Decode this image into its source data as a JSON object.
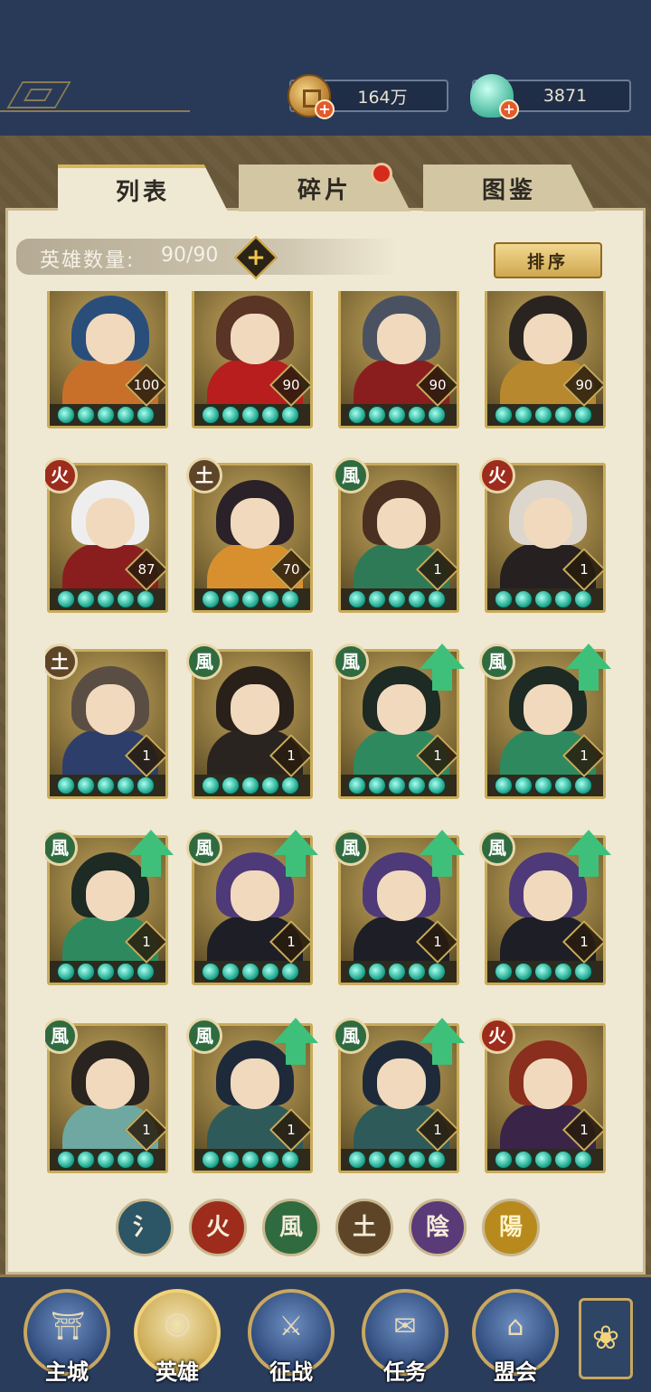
{
  "resources": {
    "coin_amount": "164万",
    "jade_amount": "3871"
  },
  "tabs": [
    {
      "label": "列表",
      "active": true
    },
    {
      "label": "碎片",
      "active": false,
      "notification": true
    },
    {
      "label": "图鉴",
      "active": false
    }
  ],
  "hero_count": {
    "label": "英雄数量:",
    "value": "90/90"
  },
  "sort_button": "排序",
  "element_glyphs": {
    "water": "氵",
    "fire": "火",
    "wind": "風",
    "earth": "土",
    "yin": "陰",
    "yang": "陽"
  },
  "element_colors": {
    "water": "#2c5566",
    "fire": "#9e2c1c",
    "wind": "#2f6b3f",
    "earth": "#5e4528",
    "yin": "#5b3a78",
    "yang": "#b88a1e"
  },
  "heroes": [
    {
      "level": "100",
      "element": null,
      "upgrade": false,
      "hair": "#2a4e7a",
      "outfit": "#c8702a"
    },
    {
      "level": "90",
      "element": null,
      "upgrade": false,
      "hair": "#5a3424",
      "outfit": "#b81e1e"
    },
    {
      "level": "90",
      "element": null,
      "upgrade": false,
      "hair": "#4a5262",
      "outfit": "#8a1e1e"
    },
    {
      "level": "90",
      "element": null,
      "upgrade": false,
      "hair": "#2a2420",
      "outfit": "#b8882e"
    },
    {
      "level": "87",
      "element": "fire",
      "upgrade": false,
      "hair": "#eeeeee",
      "outfit": "#8a1e1e"
    },
    {
      "level": "70",
      "element": "earth",
      "upgrade": false,
      "hair": "#2a2228",
      "outfit": "#d8902e"
    },
    {
      "level": "1",
      "element": "wind",
      "upgrade": false,
      "hair": "#4a3020",
      "outfit": "#2e7a56"
    },
    {
      "level": "1",
      "element": "fire",
      "upgrade": false,
      "hair": "#ddd6cc",
      "outfit": "#262020"
    },
    {
      "level": "1",
      "element": "earth",
      "upgrade": false,
      "hair": "#5a4e44",
      "outfit": "#2e3e6a"
    },
    {
      "level": "1",
      "element": "wind",
      "upgrade": false,
      "hair": "#2a201a",
      "outfit": "#2a2420"
    },
    {
      "level": "1",
      "element": "wind",
      "upgrade": true,
      "hair": "#1e2a24",
      "outfit": "#2e8a5e"
    },
    {
      "level": "1",
      "element": "wind",
      "upgrade": true,
      "hair": "#1e2a24",
      "outfit": "#2e8a5e"
    },
    {
      "level": "1",
      "element": "wind",
      "upgrade": true,
      "hair": "#1e2a24",
      "outfit": "#2e8a5e"
    },
    {
      "level": "1",
      "element": "wind",
      "upgrade": true,
      "hair": "#4e3a78",
      "outfit": "#1e1e26"
    },
    {
      "level": "1",
      "element": "wind",
      "upgrade": true,
      "hair": "#4e3a78",
      "outfit": "#1e1e26"
    },
    {
      "level": "1",
      "element": "wind",
      "upgrade": true,
      "hair": "#4e3a78",
      "outfit": "#1e1e26"
    },
    {
      "level": "1",
      "element": "wind",
      "upgrade": false,
      "hair": "#2a2420",
      "outfit": "#6ea8a0"
    },
    {
      "level": "1",
      "element": "wind",
      "upgrade": true,
      "hair": "#1e2a3a",
      "outfit": "#2e5a5a"
    },
    {
      "level": "1",
      "element": "wind",
      "upgrade": true,
      "hair": "#1e2a3a",
      "outfit": "#2e5a5a"
    },
    {
      "level": "1",
      "element": "fire",
      "upgrade": false,
      "hair": "#8a2e1e",
      "outfit": "#3a2448"
    }
  ],
  "filters": [
    "water",
    "fire",
    "wind",
    "earth",
    "yin",
    "yang"
  ],
  "nav": [
    {
      "label": "主城",
      "icon": "city-icon",
      "glyph": "⛩",
      "active": false
    },
    {
      "label": "英雄",
      "icon": "hero-icon",
      "glyph": "☺",
      "active": true
    },
    {
      "label": "征战",
      "icon": "battle-icon",
      "glyph": "⚔",
      "active": false
    },
    {
      "label": "任务",
      "icon": "task-icon",
      "glyph": "✉",
      "active": false
    },
    {
      "label": "盟会",
      "icon": "guild-icon",
      "glyph": "⌂",
      "active": false
    }
  ],
  "more_icon": "flower-menu-icon"
}
